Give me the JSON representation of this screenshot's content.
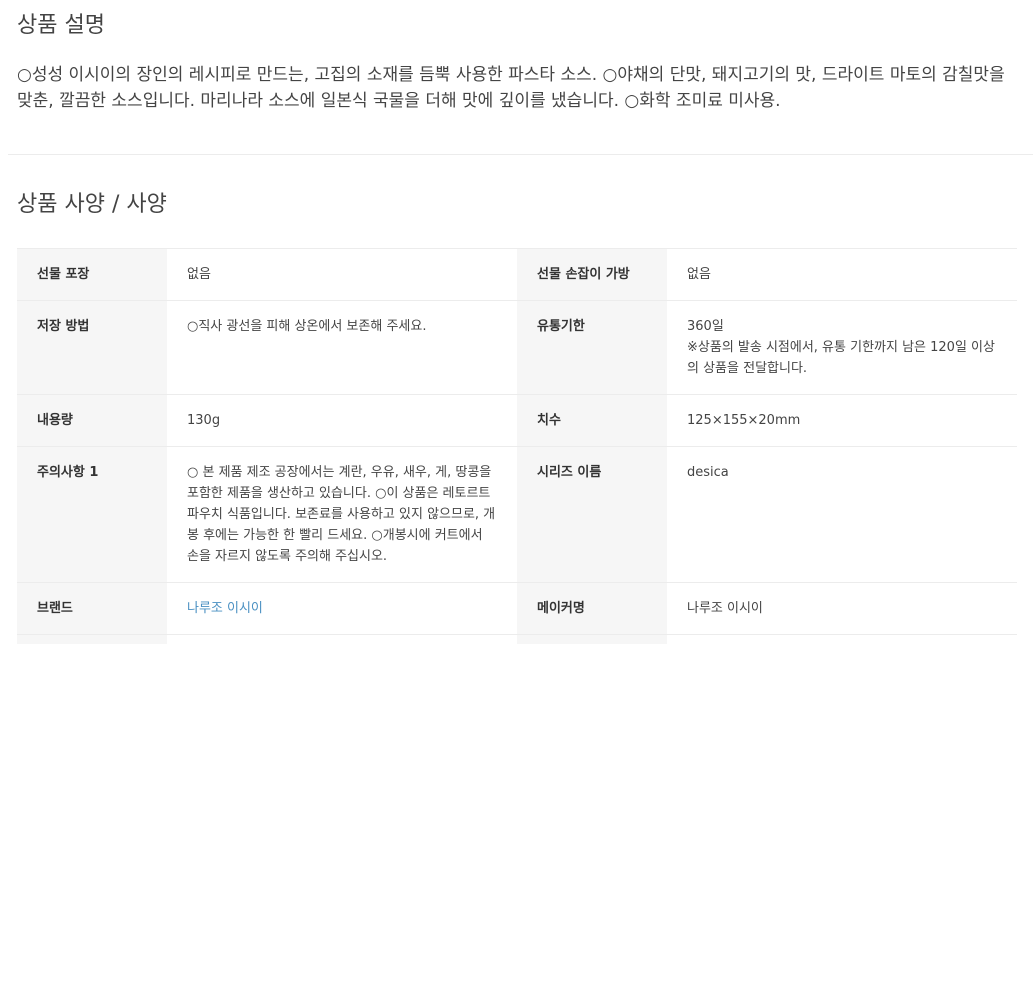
{
  "description": {
    "title": "상품 설명",
    "body": "○성성 이시이의 장인의 레시피로 만드는, 고집의 소재를 듬뿍 사용한 파스타 소스. ○야채의 단맛, 돼지고기의 맛, 드라이트 마토의 감칠맛을 맞춘, 깔끔한 소스입니다. 마리나라 소스에 일본식 국물을 더해 맛에 깊이를 냈습니다. ○화학 조미료 미사용."
  },
  "specs": {
    "title": "상품 사양 / 사양",
    "rows": [
      {
        "left_label": "선물 포장",
        "left_value": "없음",
        "right_label": "선물 손잡이 가방",
        "right_value": "없음"
      },
      {
        "left_label": "저장 방법",
        "left_value": "○직사 광선을 피해 상온에서 보존해 주세요.",
        "right_label": "유통기한",
        "right_value": "360일\n※상품의 발송 시점에서, 유통 기한까지 남은 120일 이상의 상품을 전달합니다."
      },
      {
        "left_label": "내용량",
        "left_value": "130g",
        "right_label": "치수",
        "right_value": "125×155×20mm"
      },
      {
        "left_label": "주의사항 1",
        "left_value": "○ 본 제품 제조 공장에서는 계란, 우유, 새우, 게, 땅콩을 포함한 제품을 생산하고 있습니다. ○이 상품은 레토르트 파우치 식품입니다. 보존료를 사용하고 있지 않으므로, 개봉 후에는 가능한 한 빨리 드세요. ○개봉시에 커트에서 손을 자르지 않도록 주의해 주십시오.",
        "right_label": "시리즈 이름",
        "right_value": "desica"
      },
      {
        "left_label": "브랜드",
        "left_value": "나루조 이시이",
        "right_label": "메이커명",
        "right_value": "나루조 이시이"
      }
    ]
  },
  "colors": {
    "link": "#4a90c2",
    "label_bg": "#f6f6f6",
    "border": "#ececec"
  }
}
